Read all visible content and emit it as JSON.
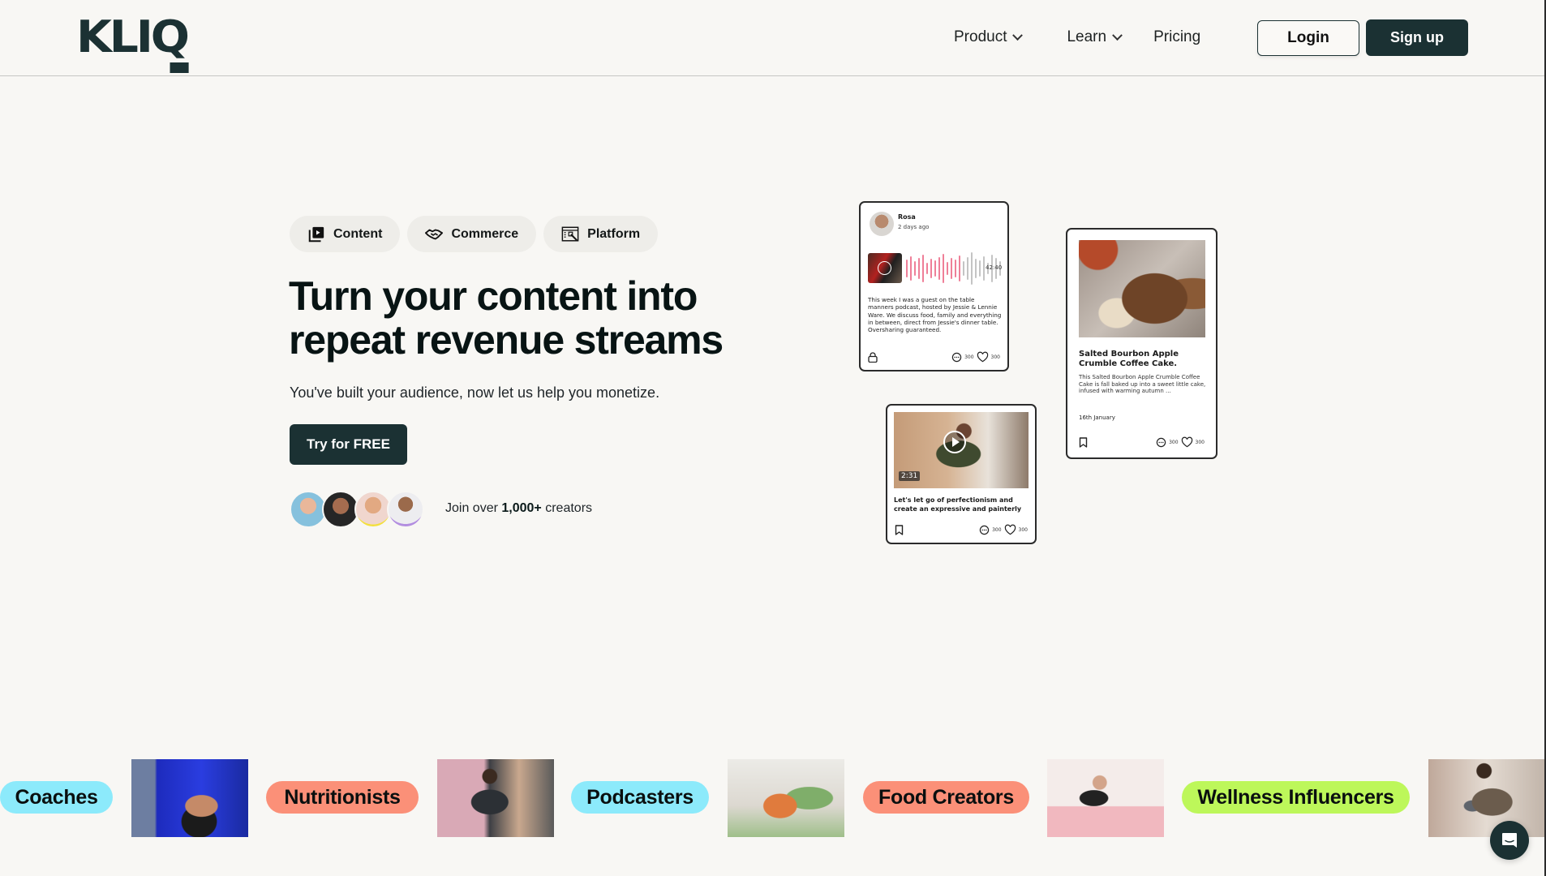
{
  "header": {
    "logo": "KLIQ",
    "nav": [
      {
        "label": "Product",
        "has_dropdown": true
      },
      {
        "label": "Learn",
        "has_dropdown": true
      },
      {
        "label": "Pricing",
        "has_dropdown": false
      }
    ],
    "login_label": "Login",
    "signup_label": "Sign up"
  },
  "hero": {
    "chips": [
      {
        "label": "Content",
        "icon": "video-library-icon"
      },
      {
        "label": "Commerce",
        "icon": "handshake-icon"
      },
      {
        "label": "Platform",
        "icon": "dashboard-window-icon"
      }
    ],
    "title_line1": "Turn your content into",
    "title_line2": "repeat revenue streams",
    "subtitle": "You've built your audience, now let us help you monetize.",
    "cta_label": "Try for FREE",
    "join_prefix": "Join over",
    "join_count": "1,000+",
    "join_suffix": "creators"
  },
  "cards": {
    "podcast": {
      "author": "Rosa",
      "time": "2 days ago",
      "duration": "42:40",
      "text": "This week I was a guest on the table manners podcast, hosted by Jessie & Lennie Ware. We discuss food, family and everything in between, direct from Jessie's dinner table. Oversharing guaranteed.",
      "comments": "300",
      "likes": "300",
      "progress_played": 0.55
    },
    "recipe": {
      "title": "Salted Bourbon Apple Crumble Coffee Cake.",
      "description": "This Salted Bourbon Apple Crumble Coffee Cake is fall baked up into a sweet little cake, infused with warming autumn ...",
      "date": "16th January",
      "comments": "300",
      "likes": "300"
    },
    "video": {
      "duration": "2:31",
      "title": "Let's let go of perfectionism and create an expressive and painterly",
      "comments": "300",
      "likes": "300"
    }
  },
  "categories": [
    {
      "label": "Coaches",
      "color": "#8ceafb"
    },
    {
      "label": "Nutritionists",
      "color": "#fb9078"
    },
    {
      "label": "Podcasters",
      "color": "#8ceafb"
    },
    {
      "label": "Food Creators",
      "color": "#fb9078"
    },
    {
      "label": "Wellness Influencers",
      "color": "#bdf75a"
    }
  ],
  "colors": {
    "brand_dark": "#1b3133",
    "background": "#f8f7f4",
    "chip_bg": "#eeede9",
    "waveform_played": "#ef7f98",
    "waveform_unplayed": "#c4c4c4"
  }
}
